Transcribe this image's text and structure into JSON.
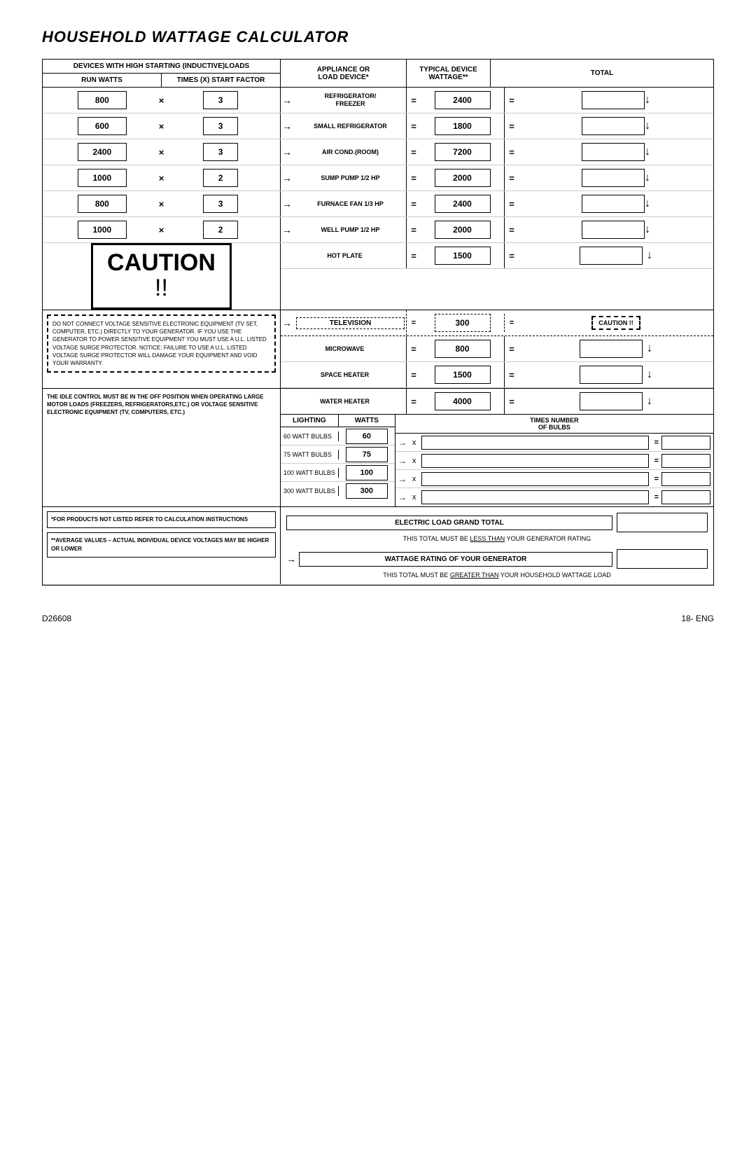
{
  "title": "HOUSEHOLD WATTAGE CALCULATOR",
  "header": {
    "col1_top": "DEVICES WITH HIGH STARTING (INDUCTIVE)LOADS",
    "col1_sub1": "RUN WATTS",
    "col1_sub2": "TIMES (X) START FACTOR",
    "col2": "APPLIANCE OR\nLOAD DEVICE*",
    "col3": "TYPICAL DEVICE\nWATTAGE**",
    "col4": "TOTAL"
  },
  "inductive_rows": [
    {
      "run_watts": "800",
      "factor": "3",
      "device": "REFRIGERATOR/\nFREEZER",
      "wattage": "2400"
    },
    {
      "run_watts": "600",
      "factor": "3",
      "device": "SMALL REFRIGERATOR",
      "wattage": "1800"
    },
    {
      "run_watts": "2400",
      "factor": "3",
      "device": "AIR COND.(ROOM)",
      "wattage": "7200"
    },
    {
      "run_watts": "1000",
      "factor": "2",
      "device": "SUMP PUMP 1/2 HP",
      "wattage": "2000"
    },
    {
      "run_watts": "800",
      "factor": "3",
      "device": "FURNACE FAN 1/3 HP",
      "wattage": "2400"
    },
    {
      "run_watts": "1000",
      "factor": "2",
      "device": "WELL PUMP 1/2 HP",
      "wattage": "2000"
    }
  ],
  "caution": {
    "text": "CAUTION",
    "exclaim": "!!"
  },
  "hot_plate": {
    "device": "HOT PLATE",
    "wattage": "1500"
  },
  "caution_warning": {
    "text": "DO NOT CONNECT VOLTAGE SENSITIVE ELECTRONIC EQUIPMENT (TV SET, COMPUTER, ETC.) DIRECTLY TO YOUR GENERATOR. IF YOU USE THE GENERATOR TO POWER SENSITIVE EQUIPMENT YOU MUST USE A U.L. LISTED VOLTAGE SURGE PROTECTOR.\n\nNOTICE: FAILURE TO USE A U.L. LISTED VOLTAGE SURGE PROTECTOR WILL DAMAGE YOUR EQUIPMENT AND VOID YOUR WARRANTY."
  },
  "television": {
    "device": "TELEVISION",
    "wattage": "300",
    "caution_label": "CAUTION !!"
  },
  "microwave": {
    "device": "MICROWAVE",
    "wattage": "800"
  },
  "space_heater": {
    "device": "SPACE HEATER",
    "wattage": "1500"
  },
  "idle_note": "THE IDLE CONTROL MUST BE IN THE OFF POSITION WHEN OPERATING LARGE MOTOR LOADS (FREEZERS, REFRIGERATORS,ETC.) OR VOLTAGE SENSITIVE ELECTRONIC EQUIPMENT (TV, COMPUTERS, ETC.)",
  "water_heater": {
    "device": "WATER HEATER",
    "wattage": "4000"
  },
  "lighting": {
    "header1": "LIGHTING",
    "header2": "WATTS",
    "header3": "TIMES NUMBER\nOF BULBS",
    "rows": [
      {
        "label": "60 WATT BULBS",
        "watts": "60"
      },
      {
        "label": "75 WATT BULBS",
        "watts": "75"
      },
      {
        "label": "100 WATT BULBS",
        "watts": "100"
      },
      {
        "label": "300 WATT BULBS",
        "watts": "300"
      }
    ]
  },
  "footnotes": {
    "star": "*FOR PRODUCTS NOT LISTED REFER TO CALCULATION INSTRUCTIONS",
    "doublestar": "**AVERAGE VALUES – ACTUAL INDIVIDUAL DEVICE VOLTAGES MAY BE HIGHER OR LOWER"
  },
  "grand_total": {
    "label": "ELECTRIC LOAD GRAND TOTAL",
    "note1": "THIS TOTAL MUST BE",
    "note1_underline": "LESS THAN",
    "note1_end": "YOUR GENERATOR RATING"
  },
  "generator": {
    "label": "WATTAGE RATING OF YOUR GENERATOR",
    "note2": "THIS TOTAL MUST BE",
    "note2_underline": "GREATER THAN",
    "note2_end": "YOUR HOUSEHOLD WATTAGE LOAD"
  },
  "footer": {
    "left": "D26608",
    "right": "18- ENG"
  },
  "symbols": {
    "arrow_right": "→",
    "arrow_down": "↓",
    "multiply": "×",
    "equals": "="
  }
}
